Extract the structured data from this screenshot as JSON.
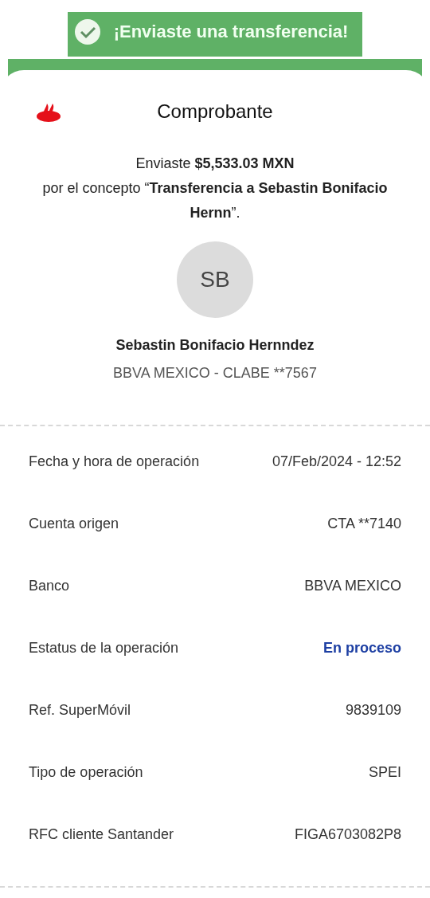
{
  "banner": {
    "text": "¡Enviaste una transferencia!"
  },
  "header": {
    "title": "Comprobante"
  },
  "summary": {
    "amount_line": "Enviaste **$5,533.03 MXN**",
    "concept_line": "por el concepto “**Transferencia a Sebastin Bonifacio Hernn**”."
  },
  "recipient": {
    "initials": "SB",
    "name": "Sebastin Bonifacio Hernndez",
    "account": "BBVA MEXICO - CLABE **7567"
  },
  "details": [
    {
      "label": "Fecha y hora de operación",
      "value": "07/Feb/2024 - 12:52",
      "kind": "text"
    },
    {
      "label": "Cuenta origen",
      "value": "CTA **7140",
      "kind": "text"
    },
    {
      "label": "Banco",
      "value": "BBVA MEXICO",
      "kind": "text"
    },
    {
      "label": "Estatus de la operación",
      "value": "En proceso",
      "kind": "status"
    },
    {
      "label": "Ref. SuperMóvil",
      "value": "9839109",
      "kind": "text"
    },
    {
      "label": "Tipo de operación",
      "value": "SPEI",
      "kind": "text"
    },
    {
      "label": "RFC cliente Santander",
      "value": "FIGA6703082P8",
      "kind": "text"
    }
  ]
}
